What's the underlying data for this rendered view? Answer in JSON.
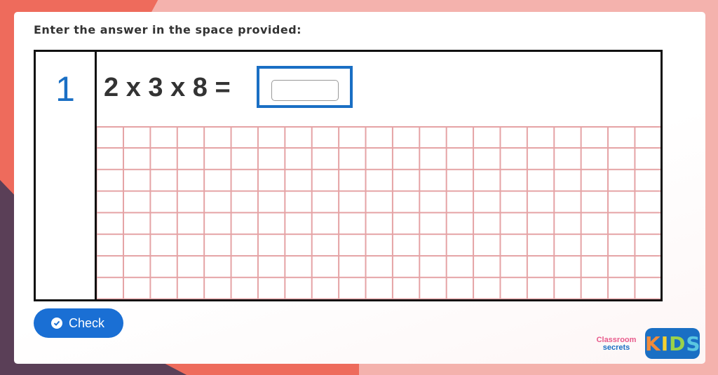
{
  "instruction": "Enter the answer in the space provided:",
  "question": {
    "number": "1",
    "equation": "2 x 3 x 8 =",
    "answer_value": "",
    "answer_placeholder": ""
  },
  "check_button": {
    "label": "Check"
  },
  "branding": {
    "classroom_line1": "Classroom",
    "classroom_line2": "secrets",
    "kids_letters": [
      "K",
      "I",
      "D",
      "S"
    ]
  },
  "colors": {
    "accent_blue": "#1a6fc4",
    "button_blue": "#1a6fd4",
    "grid_pink": "#e5a3a5",
    "bg_salmon": "#f4b2ad",
    "bg_coral": "#ee6b5c",
    "bg_plum": "#5a3f57"
  }
}
